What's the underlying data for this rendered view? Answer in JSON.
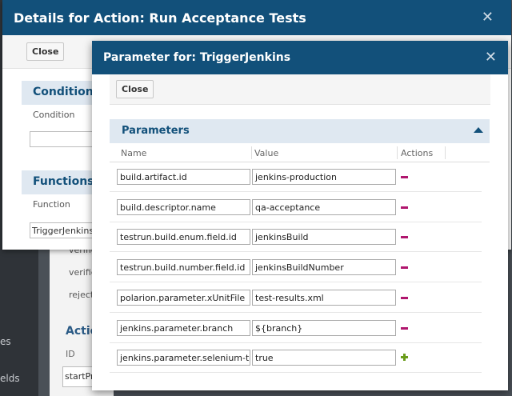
{
  "background": {
    "sidebar_labels": [
      "es",
      "elds"
    ],
    "rows": [
      "verifie",
      "verifie",
      "rejecte"
    ],
    "actions_title": "Actio",
    "id_label": "ID",
    "start_cell": "startPro"
  },
  "dialog1": {
    "title": "Details for Action: Run Acceptance Tests",
    "close_label": "Close",
    "conditions_title": "Conditions",
    "condition_label": "Condition",
    "functions_title": "Functions",
    "function_label": "Function",
    "function_value": "TriggerJenkins"
  },
  "dialog2": {
    "title": "Parameter for: TriggerJenkins",
    "close_label": "Close",
    "section_title": "Parameters",
    "columns": {
      "name": "Name",
      "value": "Value",
      "actions": "Actions"
    },
    "rows": [
      {
        "name": "build.artifact.id",
        "value": "jenkins-production",
        "action": "remove"
      },
      {
        "name": "build.descriptor.name",
        "value": "qa-acceptance",
        "action": "remove"
      },
      {
        "name": "testrun.build.enum.field.id",
        "value": "jenkinsBuild",
        "action": "remove"
      },
      {
        "name": "testrun.build.number.field.id",
        "value": "jenkinsBuildNumber",
        "action": "remove"
      },
      {
        "name": "polarion.parameter.xUnitFile",
        "value": "test-results.xml",
        "action": "remove"
      },
      {
        "name": "jenkins.parameter.branch",
        "value": "${branch}",
        "action": "remove"
      },
      {
        "name": "jenkins.parameter.selenium-tests",
        "value": "true",
        "action": "add"
      }
    ]
  },
  "colors": {
    "header": "#12507a",
    "section": "#dfe8f1",
    "remove": "#b0166e",
    "add": "#6a9c1a"
  }
}
